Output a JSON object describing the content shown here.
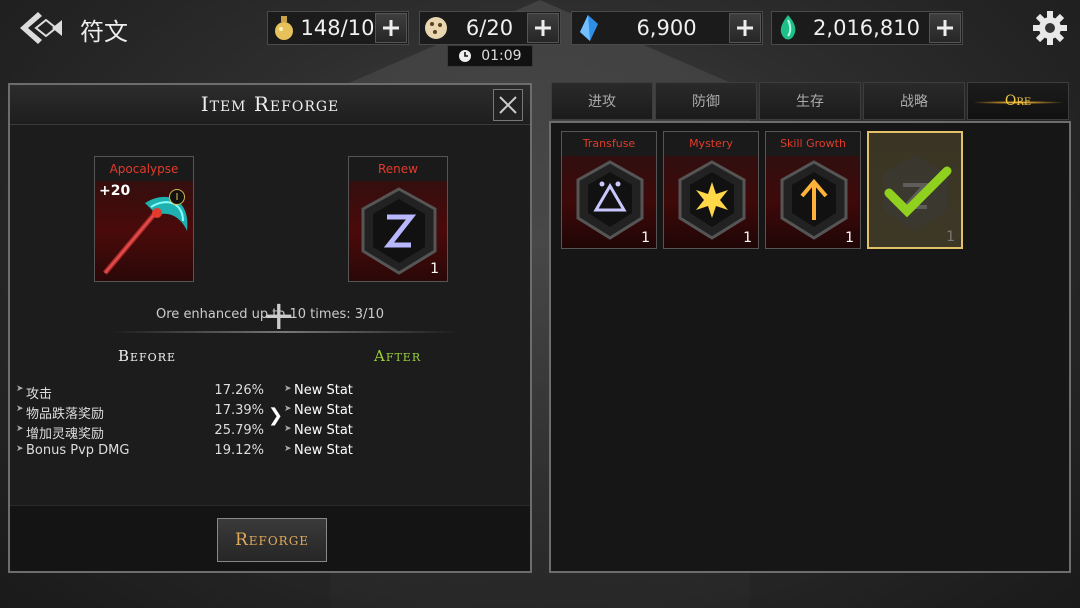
{
  "topbar": {
    "title": "符文",
    "resources": [
      {
        "name": "potion",
        "value": "148/10"
      },
      {
        "name": "dice",
        "value": "6/20"
      },
      {
        "name": "blue-crystal",
        "value": "6,900"
      },
      {
        "name": "green-gem",
        "value": "2,016,810"
      }
    ],
    "timer": "01:09"
  },
  "reforge": {
    "title": "Item Reforge",
    "item": {
      "name": "Apocalypse",
      "level": "+20",
      "tier": "I"
    },
    "ore": {
      "name": "Renew",
      "count": "1"
    },
    "enhance_text": "Ore enhanced up to 10 times: 3/10",
    "before_label": "Before",
    "after_label": "After",
    "stats": [
      {
        "name": "攻击",
        "value": "17.26%",
        "after": "New Stat"
      },
      {
        "name": "物品跌落奖励",
        "value": "17.39%",
        "after": "New Stat"
      },
      {
        "name": "增加灵魂奖励",
        "value": "25.79%",
        "after": "New Stat"
      },
      {
        "name": "Bonus Pvp DMG",
        "value": "19.12%",
        "after": "New Stat"
      }
    ],
    "button_label": "Reforge"
  },
  "tabs": [
    {
      "label": "进攻",
      "active": false
    },
    {
      "label": "防御",
      "active": false
    },
    {
      "label": "生存",
      "active": false
    },
    {
      "label": "战略",
      "active": false
    },
    {
      "label": "Ore",
      "active": true
    }
  ],
  "ores": [
    {
      "name": "Transfuse",
      "count": "1",
      "glyph": "triangle-rune",
      "color": "#c8c8ff"
    },
    {
      "name": "Mystery",
      "count": "1",
      "glyph": "star-rune",
      "color": "#ffd84a"
    },
    {
      "name": "Skill Growth",
      "count": "1",
      "glyph": "arrow-up-rune",
      "color": "#ffb23a"
    },
    {
      "name": "Renew",
      "count": "1",
      "glyph": "checkmark",
      "selected": true,
      "color": "#8fd11e"
    }
  ]
}
